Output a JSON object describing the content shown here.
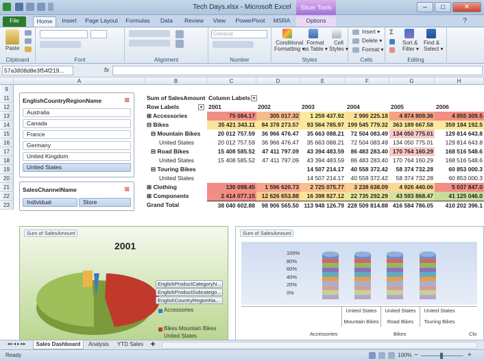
{
  "window": {
    "title": "Tech Days.xlsx - Microsoft Excel",
    "context_tab": "Slicer Tools",
    "min": "–",
    "max": "□",
    "close": "✕"
  },
  "tabs": [
    "File",
    "Home",
    "Insert",
    "Page Layout",
    "Formulas",
    "Data",
    "Review",
    "View",
    "PowerPivot",
    "MSRA",
    "Options"
  ],
  "ribbon": {
    "paste": "Paste",
    "clipboard": "Clipboard",
    "font": "Font",
    "alignment": "Alignment",
    "number_format": "General",
    "number": "Number",
    "conditional": [
      "Conditional",
      "Formatting ▾"
    ],
    "format_table": [
      "Format",
      "as Table ▾"
    ],
    "cell_styles": [
      "Cell",
      "Styles ▾"
    ],
    "styles": "Styles",
    "insert": "Insert ▾",
    "delete": "Delete ▾",
    "format": "Format ▾",
    "cells": "Cells",
    "sort": [
      "Sort &",
      "Filter ▾"
    ],
    "find": [
      "Find &",
      "Select ▾"
    ],
    "editing": "Editing"
  },
  "formula": {
    "namebox": "57a3808d8e3f54f219...",
    "fx": "fx",
    "value": ""
  },
  "columns": [
    "A",
    "B",
    "C",
    "D",
    "E",
    "F",
    "G",
    "H"
  ],
  "rows": [
    "9",
    "10",
    "11",
    "12",
    "13",
    "14",
    "15",
    "16",
    "17",
    "18",
    "19",
    "20",
    "21",
    "22",
    "23"
  ],
  "slicer1": {
    "title": "EnglishCountryRegionName",
    "items": [
      "Australia",
      "Canada",
      "France",
      "Germany",
      "United Kingdom",
      "United States"
    ],
    "selected": 5
  },
  "slicer2": {
    "title": "SalesChannelName",
    "items": [
      "Individual",
      "Store"
    ]
  },
  "pivot": {
    "corner": "Sum of SalesAmount",
    "col_labels": "Column Labels",
    "row_labels": "Row Labels",
    "years": [
      "2001",
      "2002",
      "2003",
      "2004",
      "2005",
      "2006"
    ],
    "rows": [
      {
        "label": "⊞ Accessories",
        "vals": [
          "75 084.17",
          "305 017.32",
          "1 259 437.92",
          "2 990 225.18",
          "4 874 809.36",
          "4 855 309.5"
        ],
        "bold": true,
        "ind": 0
      },
      {
        "label": "⊟ Bikes",
        "vals": [
          "35 421 343.11",
          "84 378 273.57",
          "93 564 785.97",
          "199 545 779.32",
          "363 189 667.58",
          "359 184 192.5"
        ],
        "bold": true,
        "ind": 0
      },
      {
        "label": "⊟ Mountain Bikes",
        "vals": [
          "20 012 757.59",
          "36 966 476.47",
          "35 663 088.21",
          "72 504 083.49",
          "134 050 775.01",
          "129 814 643.8"
        ],
        "bold": true,
        "ind": 1
      },
      {
        "label": "United States",
        "vals": [
          "20 012 757.59",
          "36 966 476.47",
          "35 663 088.21",
          "72 504 083.49",
          "134 050 775.01",
          "129 814 643.8"
        ],
        "bold": false,
        "ind": 3
      },
      {
        "label": "⊟ Road Bikes",
        "vals": [
          "15 408 585.52",
          "47 411 797.09",
          "43 394 483.59",
          "86 483 283.40",
          "170 764 160.29",
          "168 516 548.6"
        ],
        "bold": true,
        "ind": 1
      },
      {
        "label": "United States",
        "vals": [
          "15 408 585.52",
          "47 411 797.09",
          "43 394 483.59",
          "86 483 283.40",
          "170 764 160.29",
          "168 516 548.6"
        ],
        "bold": false,
        "ind": 3
      },
      {
        "label": "⊟ Touring Bikes",
        "vals": [
          "",
          "",
          "14 507 214.17",
          "40 558 372.42",
          "58 374 732.28",
          "60 853 000.3"
        ],
        "bold": true,
        "ind": 1
      },
      {
        "label": "United States",
        "vals": [
          "",
          "",
          "14 507 214.17",
          "40 558 372.42",
          "58 374 732.28",
          "60 853 000.3"
        ],
        "bold": false,
        "ind": 3
      },
      {
        "label": "⊞ Clothing",
        "vals": [
          "130 098.45",
          "1 596 620.73",
          "2 725 075.77",
          "3 238 638.09",
          "4 926 440.06",
          "5 037 847.0"
        ],
        "bold": true,
        "ind": 0
      },
      {
        "label": "⊞ Components",
        "vals": [
          "2 414 077.15",
          "12 626 653.88",
          "16 398 827.12",
          "22 735 292.29",
          "43 593 868.47",
          "41 125 046.0"
        ],
        "bold": true,
        "ind": 0
      },
      {
        "label": "Grand Total",
        "vals": [
          "38 040 602.88",
          "98 906 565.50",
          "113 948 126.79",
          "228 509 814.88",
          "416 584 786.05",
          "410 202 396.1"
        ],
        "bold": true,
        "ind": 0
      }
    ]
  },
  "chart1": {
    "tag": "Sum of SalesAmount",
    "title": "2001",
    "fields": [
      "EnglishProductCategoryN...",
      "EnglishProductSubcatego...",
      "EnglishCountryRegionNa..."
    ],
    "legend": [
      "Accessories",
      "Bikes Mountain Bikes",
      "United States"
    ],
    "colors": [
      "#3a78c6",
      "#c0392b"
    ]
  },
  "chart2": {
    "tag": "Sum of SalesAmount",
    "yticks": [
      "100%",
      "80%",
      "60%",
      "40%",
      "20%",
      "0%"
    ],
    "groups": [
      [
        "United States",
        "Mountain Bikes"
      ],
      [
        "United States",
        "Road Bikes"
      ],
      [
        "United States",
        "Touring Bikes"
      ]
    ],
    "cats": [
      "Accessories",
      "Bikes",
      "Clo"
    ]
  },
  "sheets": [
    "Sales Dashboard",
    "Analysis",
    "YTD Sales"
  ],
  "status": {
    "ready": "Ready",
    "zoom": "100%",
    "zoom_minus": "−",
    "zoom_plus": "+"
  }
}
